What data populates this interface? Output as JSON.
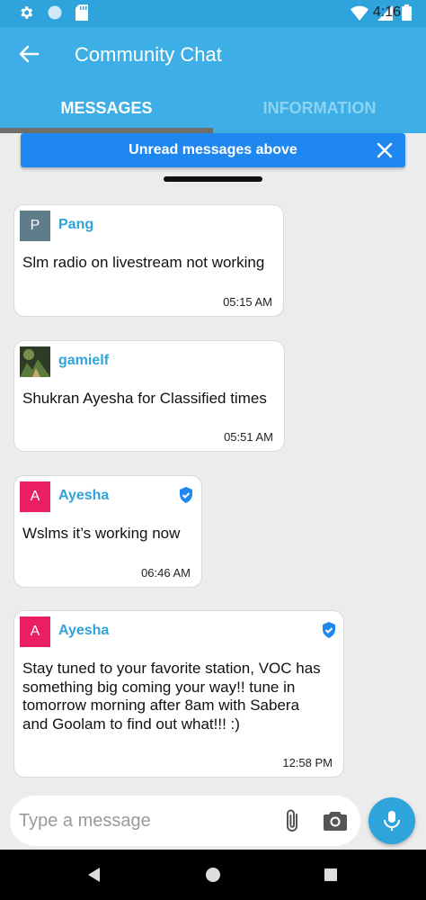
{
  "status_bar": {
    "time": "4:16",
    "icons": [
      "settings-icon",
      "circle-icon",
      "sd-card-icon",
      "wifi-icon",
      "signal-icon",
      "battery-icon"
    ]
  },
  "app_bar": {
    "title": "Community Chat",
    "back_icon": "arrow-left-icon"
  },
  "tabs": [
    {
      "label": "MESSAGES",
      "active": true
    },
    {
      "label": "INFORMATION",
      "active": false
    }
  ],
  "unread_banner": {
    "label": "Unread messages above",
    "close_icon": "close-icon"
  },
  "messages": [
    {
      "avatar_letter": "P",
      "avatar_color": "#5f7c8a",
      "sender": "Pang",
      "verified": false,
      "text": [
        "Slm radio on livestream not working"
      ],
      "time": "05:15 AM"
    },
    {
      "avatar_letter": "",
      "avatar_color": "#4a5f3a",
      "sender": "gamielf",
      "verified": false,
      "text": [
        "Shukran Ayesha for Classified times"
      ],
      "time": "05:51 AM"
    },
    {
      "avatar_letter": "A",
      "avatar_color": "#e91e63",
      "sender": "Ayesha",
      "verified": true,
      "text": [
        "Wslms it’s working now"
      ],
      "time": "06:46 AM"
    },
    {
      "avatar_letter": "A",
      "avatar_color": "#e91e63",
      "sender": "Ayesha",
      "verified": true,
      "text": [
        "Stay tuned to your favorite station, VOC has",
        "something big coming your way!! tune in",
        "tomorrow morning after 8am with Sabera",
        "and Goolam to find out what!!! :)"
      ],
      "time": "12:58 PM"
    }
  ],
  "composer": {
    "placeholder": "Type a message",
    "attach_icon": "paperclip-icon",
    "camera_icon": "camera-icon",
    "mic_icon": "microphone-icon"
  },
  "colors": {
    "primary": "#3eaee6",
    "status_bar": "#2ea3dc",
    "banner": "#1e88f0",
    "sender": "#2ea3dc",
    "verified": "#1e88f0"
  }
}
